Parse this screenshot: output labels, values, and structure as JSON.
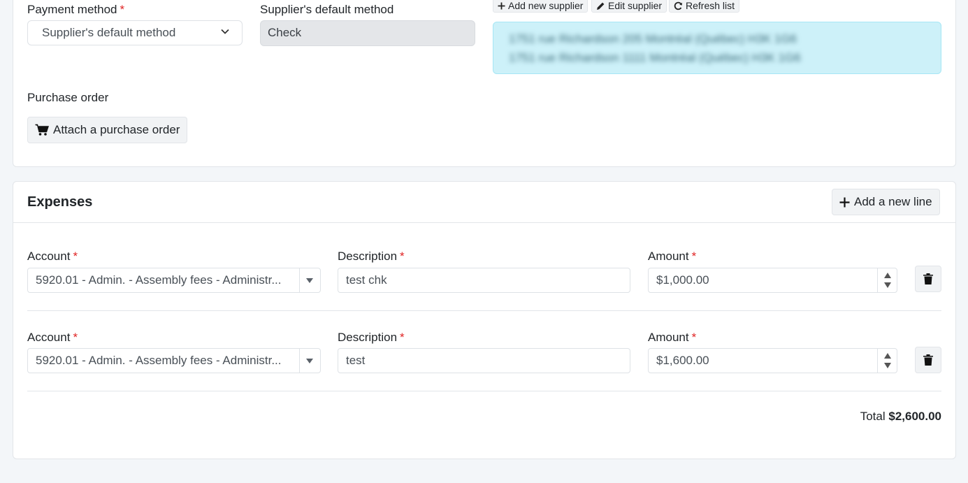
{
  "supplier_section": {
    "payment_method_label": "Payment method",
    "payment_method_value": "Supplier's default method",
    "supplier_default_label": "Supplier's default method",
    "supplier_default_value": "Check",
    "add_supplier_label": "Add new supplier",
    "edit_supplier_label": "Edit supplier",
    "refresh_list_label": "Refresh list",
    "address_line_1": "1751 rue Richardson 205 Montréal (Québec) H3K 1G6",
    "address_line_2": "1751 rue Richardson 1111 Montréal (Québec) H3K 1G6",
    "purchase_order_label": "Purchase order",
    "attach_po_label": "Attach a purchase order"
  },
  "expenses": {
    "title": "Expenses",
    "add_line_label": "Add a new line",
    "account_label": "Account",
    "description_label": "Description",
    "amount_label": "Amount",
    "required_mark": "*",
    "lines": [
      {
        "account": "5920.01 - Admin. - Assembly fees - Administr...",
        "description": "test chk",
        "amount": "$1,000.00"
      },
      {
        "account": "5920.01 - Admin. - Assembly fees - Administr...",
        "description": "test",
        "amount": "$1,600.00"
      }
    ],
    "total_label": "Total",
    "total_value": "$2,600.00"
  },
  "icons": [
    "plus-icon",
    "pencil-icon",
    "refresh-icon",
    "cart-icon",
    "chevron-down-icon",
    "caret-down-icon",
    "trash-icon"
  ]
}
